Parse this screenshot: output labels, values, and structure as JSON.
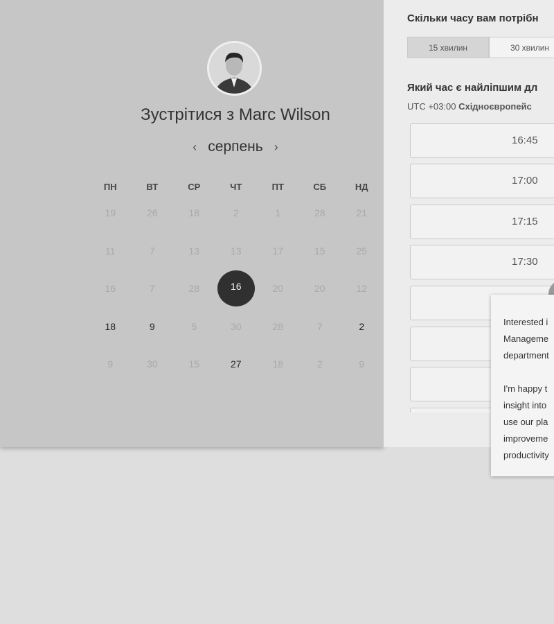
{
  "left": {
    "title_prefix": "Зустрітися з ",
    "host_name": "Marc Wilson",
    "month": "серпень",
    "prev_icon": "chevron-left-icon",
    "next_icon": "chevron-right-icon",
    "weekdays": [
      "ПН",
      "ВТ",
      "СР",
      "ЧТ",
      "ПТ",
      "СБ",
      "НД"
    ],
    "weeks": [
      [
        "19",
        "26",
        "18",
        "2",
        "1",
        "28",
        "21"
      ],
      [
        "11",
        "7",
        "13",
        "13",
        "17",
        "15",
        "25"
      ],
      [
        "16",
        "7",
        "28",
        "16",
        "20",
        "20",
        "12"
      ],
      [
        "18",
        "9",
        "5",
        "30",
        "28",
        "7",
        "2"
      ],
      [
        "9",
        "30",
        "15",
        "27",
        "18",
        "2",
        "9"
      ]
    ],
    "selected_day": "16"
  },
  "right": {
    "duration_heading": "Скільки часу вам потрібн",
    "durations": [
      "15 хвилин",
      "30 хвилин"
    ],
    "time_heading": "Який час є найліпшим дл",
    "timezone_code": "UTC +03:00",
    "timezone_name": "Східноєвропейс",
    "slots": [
      "16:45",
      "17:00",
      "17:15",
      "17:30"
    ]
  },
  "popup": {
    "paragraph1": "Interested i\nManageme\ndepartment",
    "paragraph2": "I'm happy t\ninsight into\nuse our pla\nimproveme\nproductivity"
  }
}
